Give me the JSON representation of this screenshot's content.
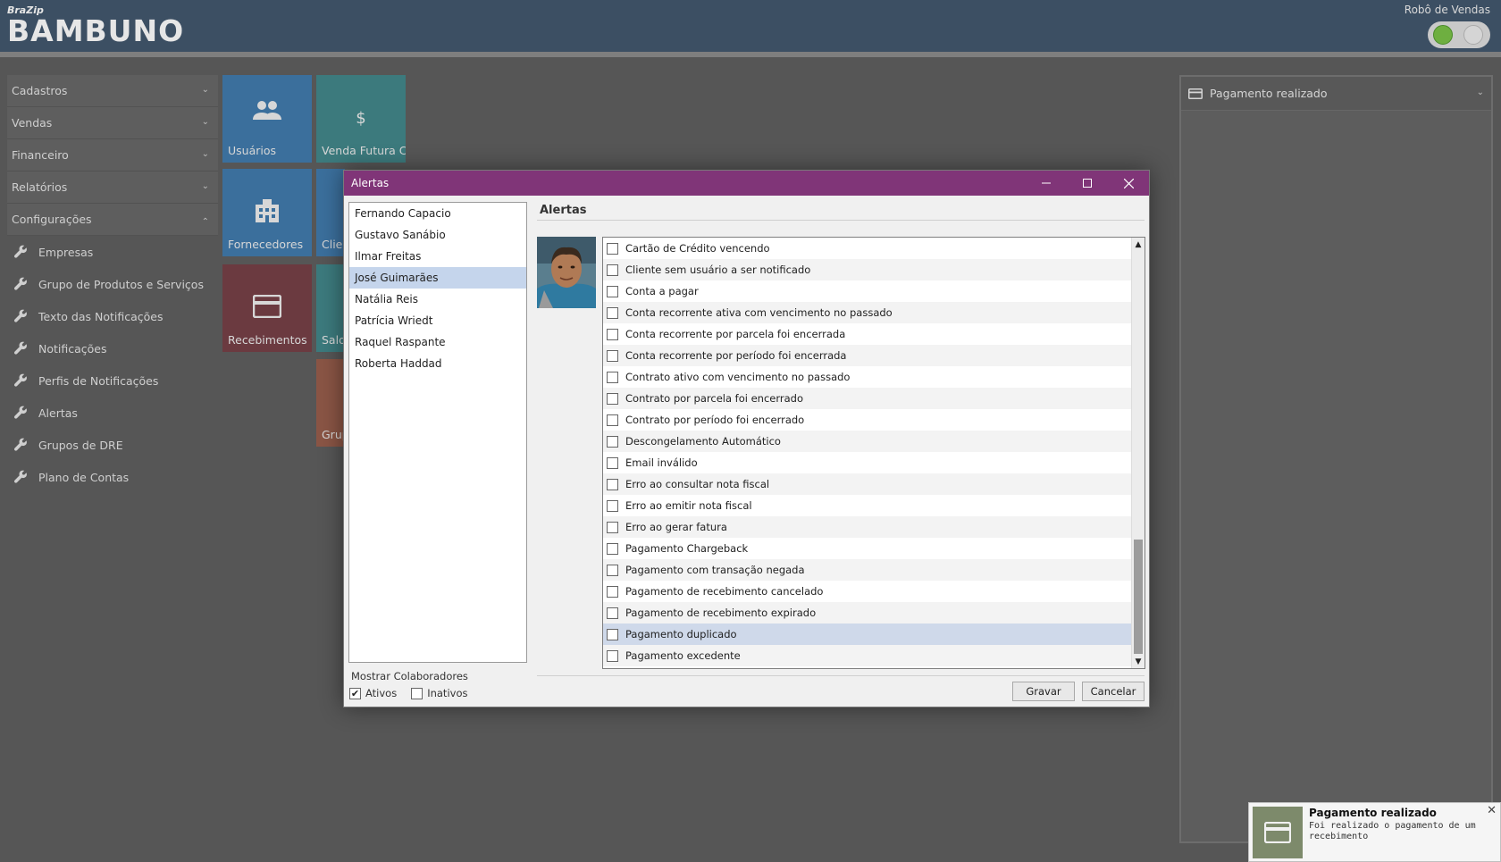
{
  "header": {
    "brand_small": "BraZip",
    "brand_big": "Bambuno",
    "robot_label": "Robô de Vendas"
  },
  "sidebar": {
    "sections": [
      {
        "label": "Cadastros",
        "expanded": false
      },
      {
        "label": "Vendas",
        "expanded": false
      },
      {
        "label": "Financeiro",
        "expanded": false
      },
      {
        "label": "Relatórios",
        "expanded": false
      },
      {
        "label": "Configurações",
        "expanded": true
      }
    ],
    "config_items": [
      "Empresas",
      "Grupo de Produtos e Serviços",
      "Texto das Notificações",
      "Notificações",
      "Perfis de Notificações",
      "Alertas",
      "Grupos de DRE",
      "Plano de Contas"
    ]
  },
  "tiles": {
    "usuarios": {
      "label": "Usuários",
      "color": "#3b6f9c"
    },
    "venda_futura": {
      "label": "Venda Futura C...",
      "color": "#3c7a7d"
    },
    "fornecedores": {
      "label": "Fornecedores",
      "color": "#3b6f9c"
    },
    "clientes": {
      "label": "Clie",
      "color": "#3b6f9c"
    },
    "recebimentos": {
      "label": "Recebimentos",
      "color": "#6b3a40"
    },
    "saldo": {
      "label": "Sald",
      "color": "#3c7a7d"
    },
    "grupo": {
      "label": "Grup",
      "color": "#8a5545"
    }
  },
  "right_panel": {
    "title": "Pagamento realizado"
  },
  "dialog": {
    "title": "Alertas",
    "heading": "Alertas",
    "users": [
      "Fernando Capacio",
      "Gustavo Sanábio",
      "Ilmar Freitas",
      "José Guimarães",
      "Natália Reis",
      "Patrícia Wriedt",
      "Raquel Raspante",
      "Roberta Haddad"
    ],
    "selected_user_index": 3,
    "show_collaborators_label": "Mostrar Colaboradores",
    "active_label": "Ativos",
    "inactive_label": "Inativos",
    "active_checked": true,
    "inactive_checked": false,
    "alerts": [
      "Cartão de Crédito vencendo",
      "Cliente sem usuário a ser notificado",
      "Conta a pagar",
      "Conta recorrente ativa com vencimento no passado",
      "Conta recorrente por parcela foi encerrada",
      "Conta recorrente por período foi encerrada",
      "Contrato ativo com vencimento no passado",
      "Contrato por parcela foi encerrado",
      "Contrato por período foi encerrado",
      "Descongelamento Automático",
      "Email inválido",
      "Erro ao consultar nota fiscal",
      "Erro ao emitir nota fiscal",
      "Erro ao gerar fatura",
      "Pagamento Chargeback",
      "Pagamento com transação negada",
      "Pagamento de recebimento cancelado",
      "Pagamento de recebimento expirado",
      "Pagamento duplicado",
      "Pagamento excedente"
    ],
    "selected_alert_index": 18,
    "save_label": "Gravar",
    "cancel_label": "Cancelar"
  },
  "toast": {
    "title": "Pagamento realizado",
    "message": "Foi realizado o pagamento de um recebimento"
  }
}
